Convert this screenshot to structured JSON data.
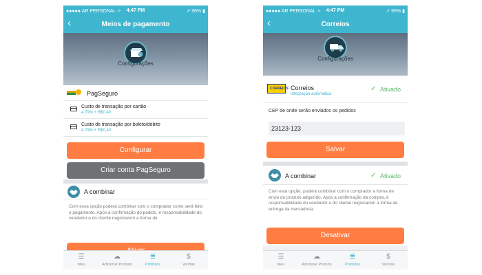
{
  "phone1": {
    "status": {
      "carrier": "●●●●● AR PERSONAL ✧",
      "time": "4:47 PM",
      "battery": "↗ 96% ▮"
    },
    "nav": {
      "back": "‹",
      "title": "Meios de pagamento"
    },
    "banner_caption": "Configurações",
    "pagseguro": {
      "name": "PagSeguro",
      "fees": [
        {
          "title": "Custo de transação por cartão",
          "value": "4.79% + R$0,40"
        },
        {
          "title": "Custo de transação por boleto/débito",
          "value": "4.79% + R$0,40"
        }
      ],
      "configure_label": "Configurar",
      "create_label": "Criar conta PagSeguro"
    },
    "combine": {
      "title": "A combinar",
      "description": "Com essa opção poderá combinar com o comprador como será feito o pagamento. Após a confirmação do pedido, é responsabilidade do vendedor e do cliente negociarem a forma de",
      "activate_label": "Ativar"
    }
  },
  "phone2": {
    "status": {
      "carrier": "●●●●● AR PERSONAL ✧",
      "time": "4:47 PM",
      "battery": "↗ 96% ▮"
    },
    "nav": {
      "back": "‹",
      "title": "Correios"
    },
    "banner_caption": "Configurações",
    "correios": {
      "logo_text": "CORREIOS",
      "name": "Correios",
      "subtitle": "Integração automática",
      "status": "Ativado",
      "cep_label": "CEP de onde serão enviados os pedidos",
      "cep_value": "23123-123",
      "save_label": "Salvar"
    },
    "combine": {
      "title": "A combinar",
      "status": "Ativado",
      "description": "Com esta opção, poderá combinar com o comprador a forma de envio do produto adquirido. Após a confirmação da compra, é responsabilidade do vendedor e do cliente negociarem a forma de entrega da mercadoria.",
      "deactivate_label": "Desativar"
    }
  },
  "tabs": [
    {
      "label": "Meu",
      "icon": "menu-icon"
    },
    {
      "label": "Adicionar Produto",
      "icon": "cloud-upload-icon"
    },
    {
      "label": "Produtos",
      "icon": "list-icon"
    },
    {
      "label": "Vendas",
      "icon": "dollar-icon"
    }
  ],
  "colors": {
    "accent": "#3fb6cf",
    "orange": "#ff7d42",
    "gray_button": "#6f7275",
    "success": "#5fb86b"
  }
}
